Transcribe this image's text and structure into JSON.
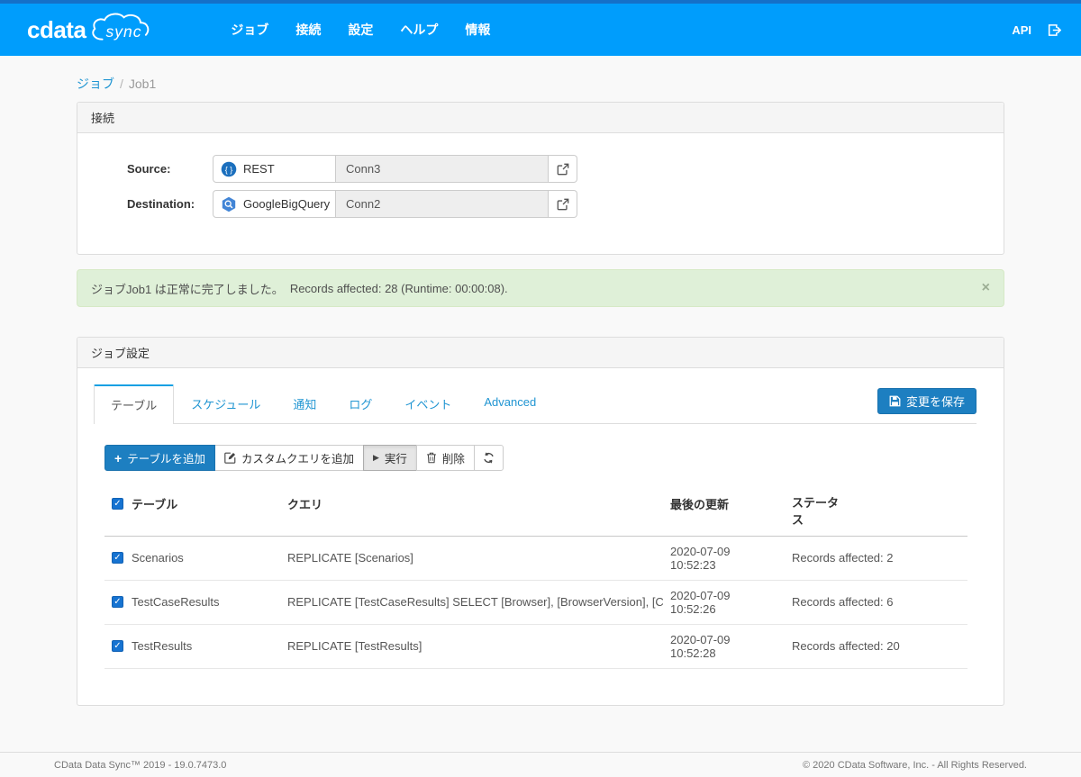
{
  "colors": {
    "navbar_bg": "#009dfc",
    "navbar_accent_strip": "#1470c8",
    "primary_button_blue": "#1d7fc1",
    "link_blue": "#2095d2",
    "active_tab_accent": "#12a0e3",
    "success_alert_bg": "#dff0d8",
    "checkbox_blue": "#1673d1"
  },
  "navbar": {
    "brand_primary": "cdata",
    "brand_secondary": "sync",
    "items": [
      {
        "label": "ジョブ"
      },
      {
        "label": "接続"
      },
      {
        "label": "設定"
      },
      {
        "label": "ヘルプ"
      },
      {
        "label": "情報"
      }
    ],
    "api_label": "API"
  },
  "breadcrumb": {
    "parent": "ジョブ",
    "separator": "/",
    "current": "Job1"
  },
  "connections": {
    "title": "接続",
    "source": {
      "label": "Source:",
      "connector": "REST",
      "connection": "Conn3"
    },
    "destination": {
      "label": "Destination:",
      "connector": "GoogleBigQuery",
      "connection": "Conn2"
    }
  },
  "alert": {
    "message_jp": "ジョブJob1 は正常に完了しました。",
    "message_en": "Records affected: 28 (Runtime: 00:00:08).",
    "close_glyph": "×"
  },
  "job_settings": {
    "title": "ジョブ設定",
    "tabs": [
      {
        "label": "テーブル"
      },
      {
        "label": "スケジュール"
      },
      {
        "label": "通知"
      },
      {
        "label": "ログ"
      },
      {
        "label": "イベント"
      },
      {
        "label": "Advanced"
      }
    ],
    "save_button_label": "変更を保存",
    "toolbar": {
      "add_table_glyph": "+",
      "add_table_label": "テーブルを追加",
      "custom_query_label": "カスタムクエリを追加",
      "run_glyph": "▶",
      "run_label": "実行",
      "delete_label": "削除"
    },
    "table": {
      "headers": {
        "table": "テーブル",
        "query": "クエリ",
        "last_update": "最後の更新",
        "status": "ステータス"
      },
      "check_glyph": "✓",
      "rows": [
        {
          "table": "Scenarios",
          "query": "REPLICATE [Scenarios]",
          "last_update": "2020-07-09 10:52:23",
          "status": "Records affected: 2"
        },
        {
          "table": "TestCaseResults",
          "query": "REPLICATE [TestCaseResults] SELECT [Browser], [BrowserVersion], [CapabilityId], [Cr...",
          "last_update": "2020-07-09 10:52:26",
          "status": "Records affected: 6"
        },
        {
          "table": "TestResults",
          "query": "REPLICATE [TestResults]",
          "last_update": "2020-07-09 10:52:28",
          "status": "Records affected: 20"
        }
      ]
    }
  },
  "footer": {
    "left": "CData Data Sync™ 2019 - 19.0.7473.0",
    "right": "© 2020 CData Software, Inc. - All Rights Reserved."
  }
}
